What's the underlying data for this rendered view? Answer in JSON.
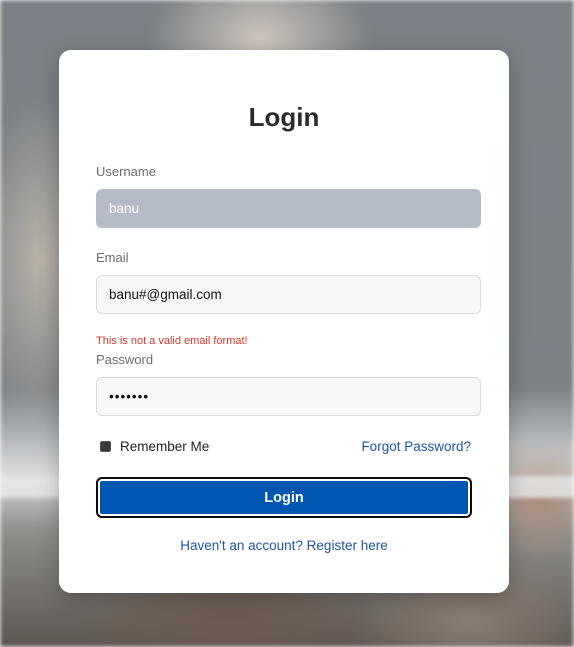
{
  "form": {
    "title": "Login",
    "username": {
      "label": "Username",
      "value": "banu"
    },
    "email": {
      "label": "Email",
      "value": "banu#@gmail.com",
      "error": "This is not a valid email format!"
    },
    "password": {
      "label": "Password",
      "value": "•••••••"
    },
    "remember_label": "Remember Me",
    "remember_checked": true,
    "forgot_label": "Forgot Password?",
    "submit_label": "Login",
    "register_label": "Haven't an account? Register here"
  },
  "colors": {
    "primary": "#0056b3",
    "link": "#1c57a5",
    "error": "#d9352b",
    "disabled_input": "#b5bbc9"
  }
}
